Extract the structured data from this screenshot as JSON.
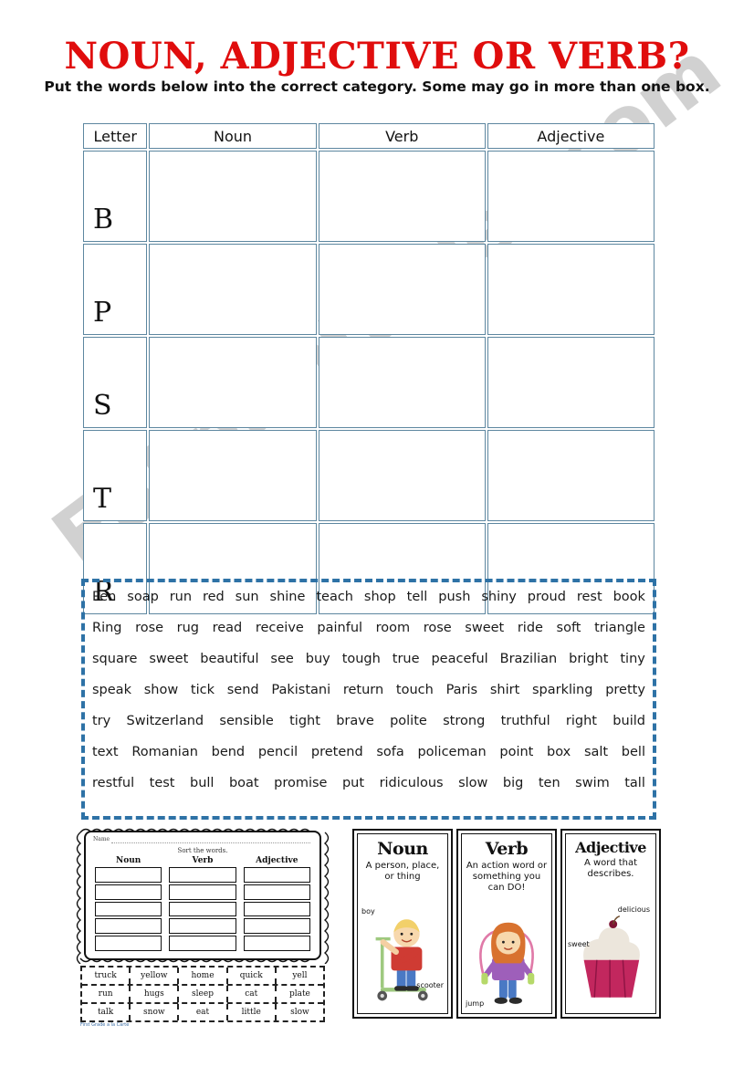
{
  "header": {
    "title": "NOUN, ADJECTIVE OR VERB?",
    "subtitle": "Put the words below into the correct category. Some may go in more than one box.",
    "title_color": "#e00d0d"
  },
  "watermark": {
    "text": "ESLprintables.com",
    "color": "#c9c9c9"
  },
  "table": {
    "border_color": "#5d87a0",
    "columns": [
      "Letter",
      "Noun",
      "Verb",
      "Adjective"
    ],
    "rows": [
      {
        "letter": "B",
        "noun": "",
        "verb": "",
        "adjective": ""
      },
      {
        "letter": "P",
        "noun": "",
        "verb": "",
        "adjective": ""
      },
      {
        "letter": "S",
        "noun": "",
        "verb": "",
        "adjective": ""
      },
      {
        "letter": "T",
        "noun": "",
        "verb": "",
        "adjective": ""
      },
      {
        "letter": "R",
        "noun": "",
        "verb": "",
        "adjective": ""
      }
    ]
  },
  "word_bank": {
    "border_color": "#2e72a6",
    "rows": [
      [
        "Pen",
        "soap",
        "run",
        "red",
        "sun",
        "shine",
        "teach",
        "shop",
        "tell",
        "push",
        "shiny",
        "proud",
        "rest",
        "book"
      ],
      [
        "Ring",
        "rose",
        "rug",
        "read",
        "receive",
        "painful",
        "room",
        "rose",
        "sweet",
        "ride",
        "soft",
        "triangle"
      ],
      [
        "square",
        "sweet",
        "beautiful",
        "see",
        "buy",
        "tough",
        "true",
        "peaceful",
        "Brazilian",
        "bright",
        "tiny"
      ],
      [
        "speak",
        "show",
        "tick",
        "send",
        "Pakistani",
        "return",
        "touch",
        "Paris",
        "shirt",
        "sparkling",
        "pretty"
      ],
      [
        "try",
        "Switzerland",
        "sensible",
        "tight",
        "brave",
        "polite",
        "strong",
        "truthful",
        "right",
        "build"
      ],
      [
        "text",
        "Romanian",
        "bend",
        "pencil",
        "pretend",
        "sofa",
        "policeman",
        "point",
        "box",
        "salt",
        "bell"
      ],
      [
        "restful",
        "test",
        "bull",
        "boat",
        "promise",
        "put",
        "ridiculous",
        "slow",
        "big",
        "ten",
        "swim",
        "tall"
      ]
    ]
  },
  "thumbnail_worksheet": {
    "name_label": "Name",
    "instruction": "Sort the words.",
    "columns": [
      "Noun",
      "Verb",
      "Adjective"
    ],
    "box_count_per_column": 5,
    "credit": "First Grade a la Carte"
  },
  "word_tiles": {
    "rows": [
      [
        "truck",
        "yellow",
        "home",
        "quick",
        "yell"
      ],
      [
        "run",
        "hugs",
        "sleep",
        "cat",
        "plate"
      ],
      [
        "talk",
        "snow",
        "eat",
        "little",
        "slow"
      ]
    ]
  },
  "posters": [
    {
      "title": "Noun",
      "description": "A person, place, or thing",
      "art": "boy-on-scooter",
      "labels": [
        "boy",
        "scooter"
      ]
    },
    {
      "title": "Verb",
      "description": "An action word or something you can DO!",
      "art": "girl-jumping-rope",
      "labels": [
        "jump"
      ]
    },
    {
      "title": "Adjective",
      "description": "A word that describes.",
      "art": "cupcake",
      "labels": [
        "delicious",
        "sweet"
      ]
    }
  ]
}
